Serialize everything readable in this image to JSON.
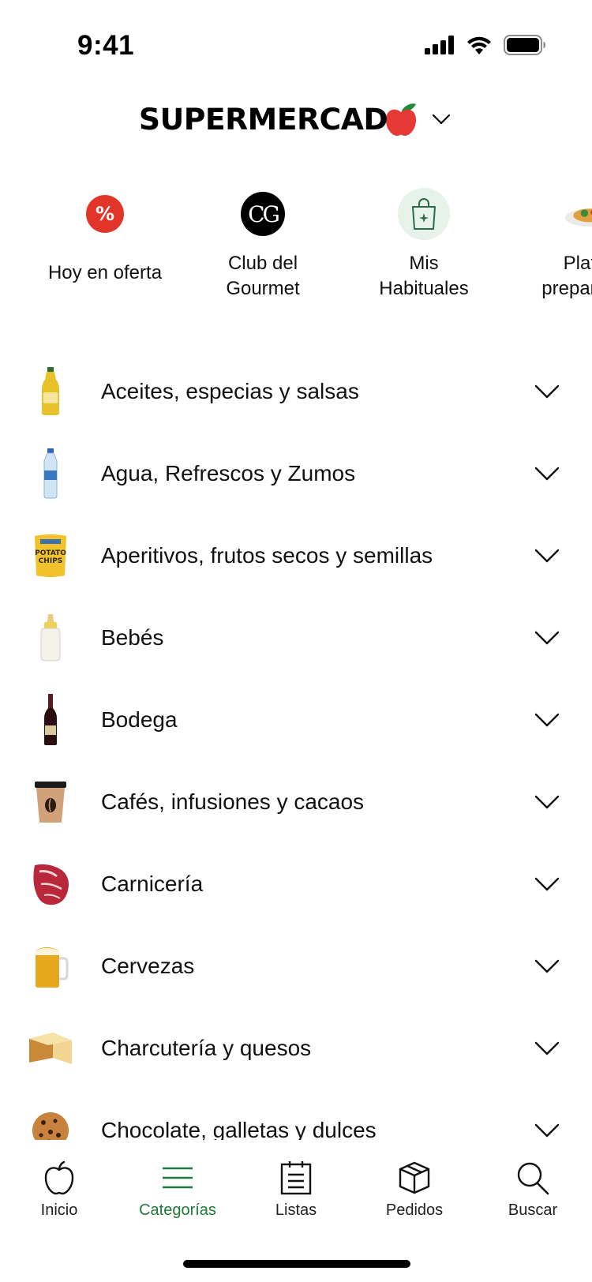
{
  "status_bar": {
    "time": "9:41"
  },
  "brand": {
    "name": "SUPERMERCADO",
    "accent_color": "#e53935",
    "leaf_color": "#1e8c3a"
  },
  "shortcuts": [
    {
      "label": "Hoy en oferta",
      "icon": "percent-badge-icon"
    },
    {
      "label": "Club del\nGourmet",
      "icon": "club-gourmet-logo-icon"
    },
    {
      "label": "Mis\nHabituales",
      "icon": "shopping-bag-sparkle-icon"
    },
    {
      "label": "Platos\npreparados",
      "icon": "prepared-dish-icon"
    }
  ],
  "categories": [
    {
      "label": "Aceites, especias y salsas",
      "icon": "oil-bottle-icon"
    },
    {
      "label": "Agua, Refrescos y Zumos",
      "icon": "water-bottle-icon"
    },
    {
      "label": "Aperitivos, frutos secos y semillas",
      "icon": "potato-chips-icon"
    },
    {
      "label": "Bebés",
      "icon": "baby-bottle-icon"
    },
    {
      "label": "Bodega",
      "icon": "wine-bottle-icon"
    },
    {
      "label": "Cafés, infusiones y cacaos",
      "icon": "coffee-cup-icon"
    },
    {
      "label": "Carnicería",
      "icon": "meat-steak-icon"
    },
    {
      "label": "Cervezas",
      "icon": "beer-mug-icon"
    },
    {
      "label": "Charcutería y quesos",
      "icon": "cheese-icon"
    },
    {
      "label": "Chocolate, galletas y dulces",
      "icon": "cookie-icon"
    }
  ],
  "chips_text": "POTATO CHIPS",
  "tabbar": {
    "active_color": "#1d7a3a",
    "tabs": [
      {
        "label": "Inicio",
        "icon": "apple-icon"
      },
      {
        "label": "Categorías",
        "icon": "menu-lines-icon",
        "active": true
      },
      {
        "label": "Listas",
        "icon": "list-calendar-icon"
      },
      {
        "label": "Pedidos",
        "icon": "package-box-icon"
      },
      {
        "label": "Buscar",
        "icon": "search-icon"
      }
    ]
  }
}
